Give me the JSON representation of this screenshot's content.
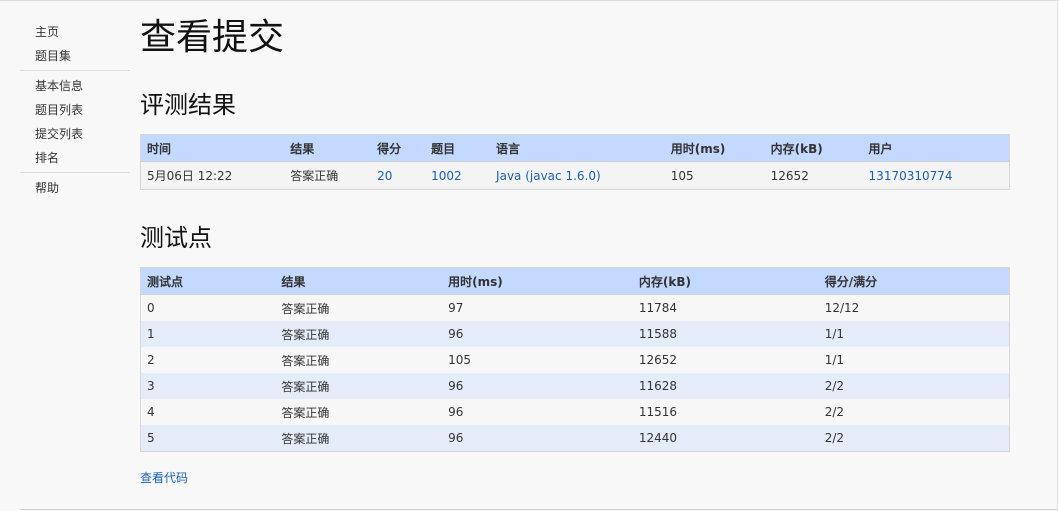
{
  "sidebar": {
    "groups": [
      {
        "items": [
          "主页",
          "题目集"
        ]
      },
      {
        "items": [
          "基本信息",
          "题目列表",
          "提交列表",
          "排名"
        ]
      },
      {
        "items": [
          "帮助"
        ]
      }
    ]
  },
  "page_title": "查看提交",
  "result_section": {
    "title": "评测结果",
    "headers": [
      "时间",
      "结果",
      "得分",
      "题目",
      "语言",
      "用时(ms)",
      "内存(kB)",
      "用户"
    ],
    "row": {
      "time": "5月06日 12:22",
      "result": "答案正确",
      "score": "20",
      "problem": "1002",
      "language": "Java (javac 1.6.0)",
      "time_ms": "105",
      "memory_kb": "12652",
      "user": "13170310774"
    }
  },
  "tests_section": {
    "title": "测试点",
    "headers": [
      "测试点",
      "结果",
      "用时(ms)",
      "内存(kB)",
      "得分/满分"
    ],
    "rows": [
      {
        "id": "0",
        "result": "答案正确",
        "time_ms": "97",
        "memory_kb": "11784",
        "score": "12/12"
      },
      {
        "id": "1",
        "result": "答案正确",
        "time_ms": "96",
        "memory_kb": "11588",
        "score": "1/1"
      },
      {
        "id": "2",
        "result": "答案正确",
        "time_ms": "105",
        "memory_kb": "12652",
        "score": "1/1"
      },
      {
        "id": "3",
        "result": "答案正确",
        "time_ms": "96",
        "memory_kb": "11628",
        "score": "2/2"
      },
      {
        "id": "4",
        "result": "答案正确",
        "time_ms": "96",
        "memory_kb": "11516",
        "score": "2/2"
      },
      {
        "id": "5",
        "result": "答案正确",
        "time_ms": "96",
        "memory_kb": "12440",
        "score": "2/2"
      }
    ]
  },
  "view_code_label": "查看代码",
  "colors": {
    "header_bg": "#c3d9ff",
    "accepted": "#cc0000",
    "link": "#1a5fb4",
    "row_alt": "#e5ecf9"
  }
}
